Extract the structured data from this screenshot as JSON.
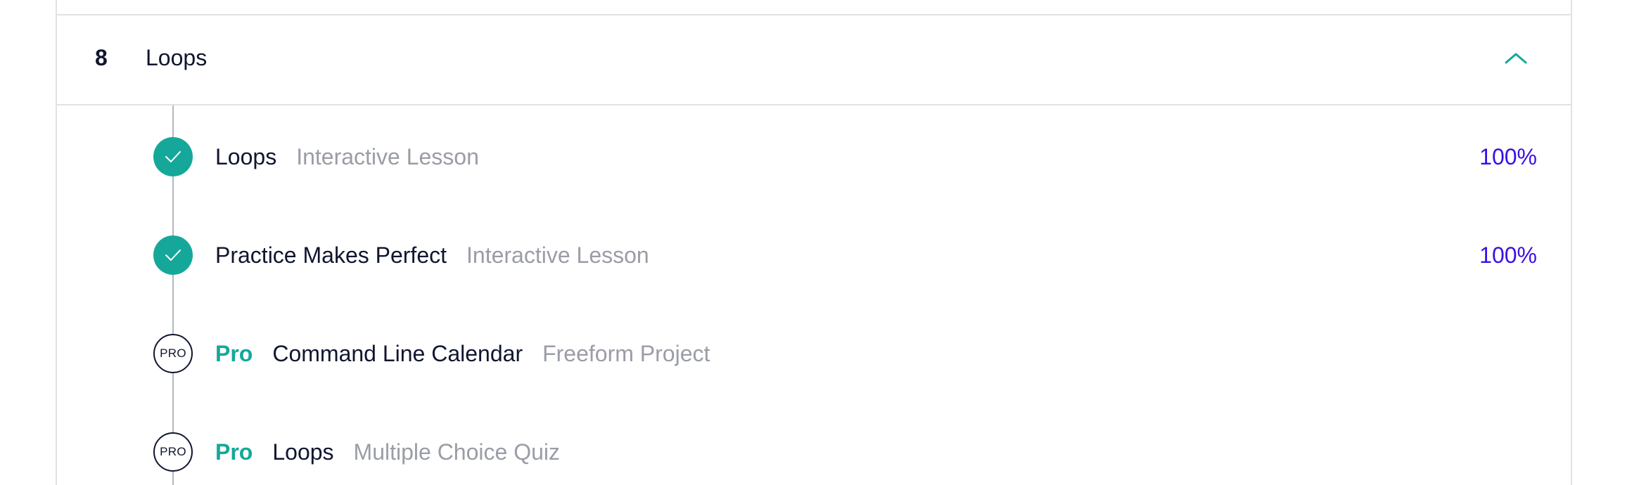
{
  "module": {
    "number": "8",
    "title": "Loops",
    "toggle_icon": "chevron-up-icon"
  },
  "colors": {
    "accent_teal": "#15a89a",
    "progress_blue": "#3a10e5",
    "text_dark": "#10162f",
    "text_muted": "#9a9da6",
    "divider": "#e1e2e4"
  },
  "lessons": [
    {
      "status": "completed",
      "status_icon": "checkmark-icon",
      "pro_label": "",
      "name": "Loops",
      "type": "Interactive Lesson",
      "progress": "100%"
    },
    {
      "status": "completed",
      "status_icon": "checkmark-icon",
      "pro_label": "",
      "name": "Practice Makes Perfect",
      "type": "Interactive Lesson",
      "progress": "100%"
    },
    {
      "status": "locked",
      "badge_text": "PRO",
      "pro_label": "Pro",
      "name": "Command Line Calendar",
      "type": "Freeform Project",
      "progress": ""
    },
    {
      "status": "locked",
      "badge_text": "PRO",
      "pro_label": "Pro",
      "name": "Loops",
      "type": "Multiple Choice Quiz",
      "progress": ""
    }
  ]
}
